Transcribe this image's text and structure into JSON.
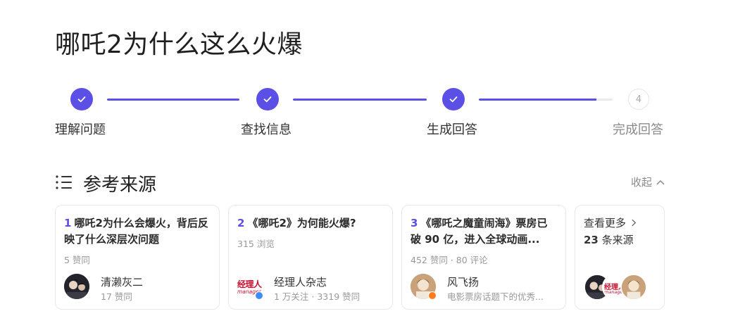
{
  "page": {
    "title": "哪吒2为什么这么火爆"
  },
  "steps": [
    {
      "label": "理解问题",
      "state": "done"
    },
    {
      "label": "查找信息",
      "state": "done"
    },
    {
      "label": "生成回答",
      "state": "done"
    },
    {
      "label": "完成回答",
      "state": "todo",
      "number": "4"
    }
  ],
  "sources": {
    "title": "参考来源",
    "collapse_label": "收起",
    "cards": [
      {
        "num": "1",
        "title": "哪吒2为什么会爆火，背后反映了什么深层次问题",
        "meta": "5 赞同",
        "author": "清濑灰二",
        "author_sub": "17 赞同"
      },
      {
        "num": "2",
        "title": "《哪吒2》为何能火爆?",
        "meta": "315 浏览",
        "author": "经理人杂志",
        "author_sub": "1 万关注 · 3319 赞同",
        "logo_text": "经理人",
        "logo_sub": "manager"
      },
      {
        "num": "3",
        "title": "《哪吒之魔童闹海》票房已破 90 亿，进入全球动画...",
        "meta": "452 赞同 · 80 评论",
        "author": "风飞扬",
        "author_sub": "电影票房话题下的优秀..."
      }
    ],
    "more": {
      "label": "查看更多",
      "count": "23",
      "count_suffix": "条来源"
    }
  },
  "colors": {
    "accent": "#5b4fe6",
    "muted": "#999999",
    "border": "#e8e8ec"
  },
  "icons": {
    "step_done": "check-icon",
    "section": "list-icon",
    "collapse": "chevron-up-icon",
    "more": "chevron-right-icon"
  }
}
